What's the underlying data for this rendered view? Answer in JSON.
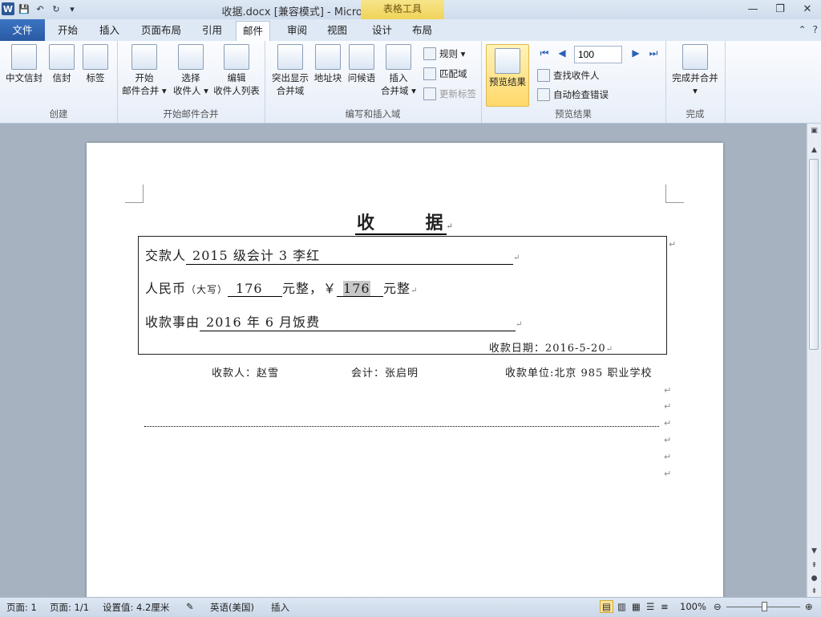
{
  "window": {
    "doc_title": "收据.docx [兼容模式] - Microsoft Word",
    "context_tab_title": "表格工具",
    "qat": {
      "word_logo": "W",
      "save_icon": "💾",
      "undo_icon": "↶",
      "redo_icon": "↻",
      "customize_icon": "▾"
    },
    "controls": {
      "minimize": "—",
      "restore": "❐",
      "close": "✕"
    }
  },
  "tabs": [
    "文件",
    "开始",
    "插入",
    "页面布局",
    "引用",
    "邮件",
    "审阅",
    "视图",
    "设计",
    "布局"
  ],
  "help_icons": {
    "collapse": "⌃",
    "help": "?"
  },
  "ribbon": {
    "groups": {
      "create": "创建",
      "start_merge": "开始邮件合并",
      "write_insert": "编写和插入域",
      "preview": "预览结果",
      "finish": "完成"
    },
    "create": {
      "chinese_envelope": "中文信封",
      "envelope": "信封",
      "labels": "标签"
    },
    "start_merge": {
      "start_1": "开始",
      "start_2": "邮件合并 ▾",
      "select_1": "选择",
      "select_2": "收件人 ▾",
      "edit_1": "编辑",
      "edit_2": "收件人列表"
    },
    "write_insert": {
      "highlight_1": "突出显示",
      "highlight_2": "合并域",
      "address_block": "地址块",
      "greeting": "问候语",
      "insert_1": "插入",
      "insert_2": "合并域 ▾",
      "rules": "规则 ▾",
      "match_fields": "匹配域",
      "update_labels": "更新标签"
    },
    "preview": {
      "preview_results": "预览结果",
      "first": "⏮",
      "prev": "◀",
      "next": "▶",
      "last": "⏭",
      "record_value": "100",
      "find_recipient": "查找收件人",
      "auto_check": "自动检查错误"
    },
    "finish": {
      "finish_1": "完成并合并",
      "finish_2": "▾"
    }
  },
  "document": {
    "title_1": "收",
    "title_2": "据",
    "payer_label": "交款人",
    "payer_value": "2015 级会计 3   李红",
    "rmb_label": "人民币",
    "rmb_paren": "（大写）",
    "amount_upper": "176",
    "yuan_1": "元整，￥",
    "amount_lower": "176",
    "yuan_2": "元整",
    "reason_label": "收款事由",
    "reason_value": "2016 年 6 月饭费",
    "date_line": "收款日期：2016-5-20",
    "receiver": "收款人：赵雪",
    "accountant": "会计：张启明",
    "unit": "收款单位:北京 985 职业学校",
    "para_mark": "↵"
  },
  "statusbar": {
    "page": "页面: 1",
    "pages": "页面: 1/1",
    "setting": "设置值: 4.2厘米",
    "language": "英语(美国)",
    "mode": "插入",
    "zoom": "100%"
  }
}
